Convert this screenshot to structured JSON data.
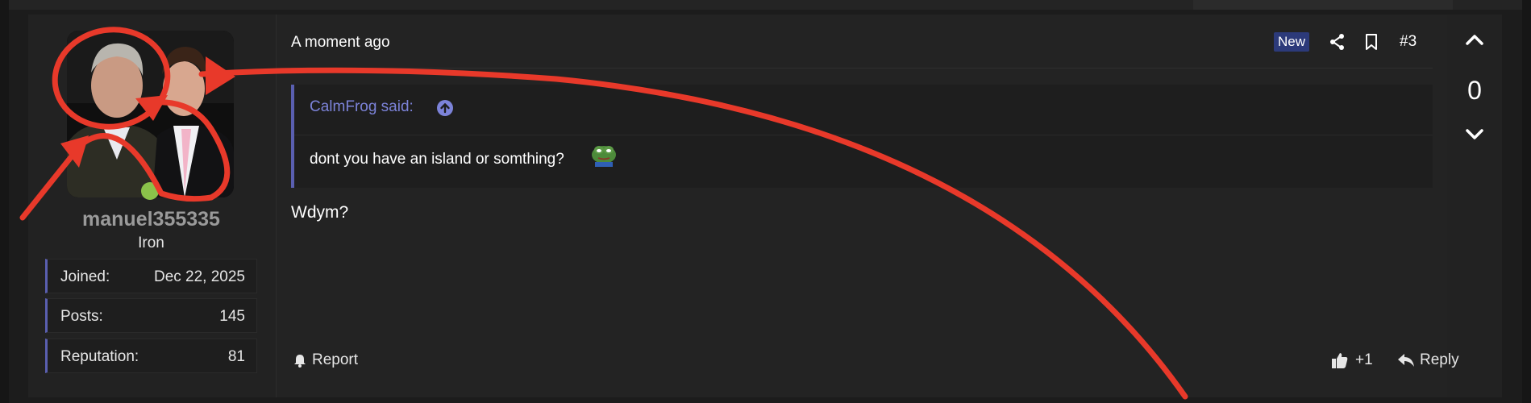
{
  "post": {
    "user": {
      "username": "manuel355335",
      "rank": "Iron",
      "stats": [
        {
          "label": "Joined:",
          "value": "Dec 22, 2025"
        },
        {
          "label": "Posts:",
          "value": "145"
        },
        {
          "label": "Reputation:",
          "value": "81"
        }
      ]
    },
    "header": {
      "timestamp": "A moment ago",
      "badge": "New",
      "post_number": "#3"
    },
    "quote": {
      "author": "CalmFrog said:",
      "text": "dont you have an island or somthing?"
    },
    "message": "Wdym?",
    "footer": {
      "report": "Report",
      "like": "+1",
      "reply": "Reply"
    },
    "votes": {
      "count": "0"
    }
  },
  "colors": {
    "accent": "#5a5fb0",
    "badge": "#2c3a7a",
    "online": "#8bc34a",
    "annotation": "#e8392a"
  }
}
